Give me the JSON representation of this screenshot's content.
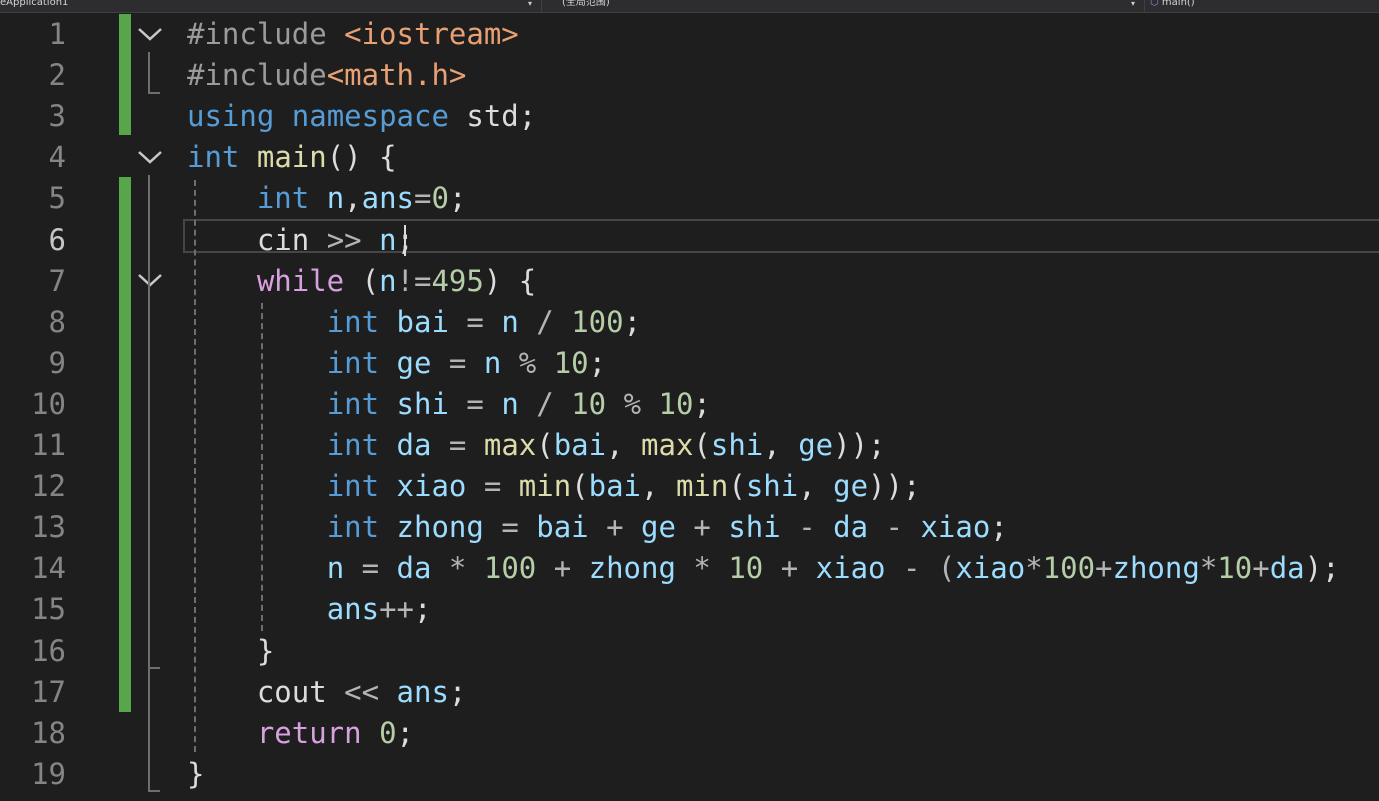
{
  "navbar": {
    "project": "eApplication1",
    "scope": "(全局范围)",
    "member": "main()"
  },
  "editor": {
    "current_line": 6,
    "lines": [
      {
        "n": "1",
        "tokens": [
          {
            "t": "#include ",
            "c": "pp"
          },
          {
            "t": "<iostream>",
            "c": "str"
          }
        ]
      },
      {
        "n": "2",
        "tokens": [
          {
            "t": "#include",
            "c": "pp"
          },
          {
            "t": "<math.h>",
            "c": "str"
          }
        ]
      },
      {
        "n": "3",
        "tokens": [
          {
            "t": "using",
            "c": "kw"
          },
          {
            "t": " ",
            "c": "pl"
          },
          {
            "t": "namespace",
            "c": "kw"
          },
          {
            "t": " std;",
            "c": "pl"
          }
        ]
      },
      {
        "n": "4",
        "tokens": [
          {
            "t": "int",
            "c": "kw"
          },
          {
            "t": " ",
            "c": "pl"
          },
          {
            "t": "main",
            "c": "fn"
          },
          {
            "t": "() {",
            "c": "pl"
          }
        ]
      },
      {
        "n": "5",
        "tokens": [
          {
            "t": "    ",
            "c": "pl"
          },
          {
            "t": "int",
            "c": "kw"
          },
          {
            "t": " ",
            "c": "pl"
          },
          {
            "t": "n",
            "c": "var"
          },
          {
            "t": ",",
            "c": "pl"
          },
          {
            "t": "ans",
            "c": "var"
          },
          {
            "t": "=",
            "c": "op"
          },
          {
            "t": "0",
            "c": "num"
          },
          {
            "t": ";",
            "c": "pl"
          }
        ]
      },
      {
        "n": "6",
        "tokens": [
          {
            "t": "    cin ",
            "c": "pl"
          },
          {
            "t": ">>",
            "c": "op"
          },
          {
            "t": " ",
            "c": "pl"
          },
          {
            "t": "n",
            "c": "var"
          },
          {
            "t": ";",
            "c": "pl"
          }
        ]
      },
      {
        "n": "7",
        "tokens": [
          {
            "t": "    ",
            "c": "pl"
          },
          {
            "t": "while",
            "c": "ctl"
          },
          {
            "t": " (",
            "c": "pl"
          },
          {
            "t": "n",
            "c": "var"
          },
          {
            "t": "!=",
            "c": "op"
          },
          {
            "t": "495",
            "c": "num"
          },
          {
            "t": ") {",
            "c": "pl"
          }
        ]
      },
      {
        "n": "8",
        "tokens": [
          {
            "t": "        ",
            "c": "pl"
          },
          {
            "t": "int",
            "c": "kw"
          },
          {
            "t": " ",
            "c": "pl"
          },
          {
            "t": "bai",
            "c": "var"
          },
          {
            "t": " = ",
            "c": "op"
          },
          {
            "t": "n",
            "c": "var"
          },
          {
            "t": " / ",
            "c": "op"
          },
          {
            "t": "100",
            "c": "num"
          },
          {
            "t": ";",
            "c": "pl"
          }
        ]
      },
      {
        "n": "9",
        "tokens": [
          {
            "t": "        ",
            "c": "pl"
          },
          {
            "t": "int",
            "c": "kw"
          },
          {
            "t": " ",
            "c": "pl"
          },
          {
            "t": "ge",
            "c": "var"
          },
          {
            "t": " = ",
            "c": "op"
          },
          {
            "t": "n",
            "c": "var"
          },
          {
            "t": " % ",
            "c": "op"
          },
          {
            "t": "10",
            "c": "num"
          },
          {
            "t": ";",
            "c": "pl"
          }
        ]
      },
      {
        "n": "10",
        "tokens": [
          {
            "t": "        ",
            "c": "pl"
          },
          {
            "t": "int",
            "c": "kw"
          },
          {
            "t": " ",
            "c": "pl"
          },
          {
            "t": "shi",
            "c": "var"
          },
          {
            "t": " = ",
            "c": "op"
          },
          {
            "t": "n",
            "c": "var"
          },
          {
            "t": " / ",
            "c": "op"
          },
          {
            "t": "10",
            "c": "num"
          },
          {
            "t": " % ",
            "c": "op"
          },
          {
            "t": "10",
            "c": "num"
          },
          {
            "t": ";",
            "c": "pl"
          }
        ]
      },
      {
        "n": "11",
        "tokens": [
          {
            "t": "        ",
            "c": "pl"
          },
          {
            "t": "int",
            "c": "kw"
          },
          {
            "t": " ",
            "c": "pl"
          },
          {
            "t": "da",
            "c": "var"
          },
          {
            "t": " = ",
            "c": "op"
          },
          {
            "t": "max",
            "c": "fn"
          },
          {
            "t": "(",
            "c": "pl"
          },
          {
            "t": "bai",
            "c": "var"
          },
          {
            "t": ", ",
            "c": "pl"
          },
          {
            "t": "max",
            "c": "fn"
          },
          {
            "t": "(",
            "c": "pl"
          },
          {
            "t": "shi",
            "c": "var"
          },
          {
            "t": ", ",
            "c": "pl"
          },
          {
            "t": "ge",
            "c": "var"
          },
          {
            "t": "));",
            "c": "pl"
          }
        ]
      },
      {
        "n": "12",
        "tokens": [
          {
            "t": "        ",
            "c": "pl"
          },
          {
            "t": "int",
            "c": "kw"
          },
          {
            "t": " ",
            "c": "pl"
          },
          {
            "t": "xiao",
            "c": "var"
          },
          {
            "t": " = ",
            "c": "op"
          },
          {
            "t": "min",
            "c": "fn"
          },
          {
            "t": "(",
            "c": "pl"
          },
          {
            "t": "bai",
            "c": "var"
          },
          {
            "t": ", ",
            "c": "pl"
          },
          {
            "t": "min",
            "c": "fn"
          },
          {
            "t": "(",
            "c": "pl"
          },
          {
            "t": "shi",
            "c": "var"
          },
          {
            "t": ", ",
            "c": "pl"
          },
          {
            "t": "ge",
            "c": "var"
          },
          {
            "t": "));",
            "c": "pl"
          }
        ]
      },
      {
        "n": "13",
        "tokens": [
          {
            "t": "        ",
            "c": "pl"
          },
          {
            "t": "int",
            "c": "kw"
          },
          {
            "t": " ",
            "c": "pl"
          },
          {
            "t": "zhong",
            "c": "var"
          },
          {
            "t": " = ",
            "c": "op"
          },
          {
            "t": "bai",
            "c": "var"
          },
          {
            "t": " + ",
            "c": "op"
          },
          {
            "t": "ge",
            "c": "var"
          },
          {
            "t": " + ",
            "c": "op"
          },
          {
            "t": "shi",
            "c": "var"
          },
          {
            "t": " - ",
            "c": "op"
          },
          {
            "t": "da",
            "c": "var"
          },
          {
            "t": " - ",
            "c": "op"
          },
          {
            "t": "xiao",
            "c": "var"
          },
          {
            "t": ";",
            "c": "pl"
          }
        ]
      },
      {
        "n": "14",
        "tokens": [
          {
            "t": "        ",
            "c": "pl"
          },
          {
            "t": "n",
            "c": "var"
          },
          {
            "t": " = ",
            "c": "op"
          },
          {
            "t": "da",
            "c": "var"
          },
          {
            "t": " * ",
            "c": "op"
          },
          {
            "t": "100",
            "c": "num"
          },
          {
            "t": " + ",
            "c": "op"
          },
          {
            "t": "zhong",
            "c": "var"
          },
          {
            "t": " * ",
            "c": "op"
          },
          {
            "t": "10",
            "c": "num"
          },
          {
            "t": " + ",
            "c": "op"
          },
          {
            "t": "xiao",
            "c": "var"
          },
          {
            "t": " - (",
            "c": "op"
          },
          {
            "t": "xiao",
            "c": "var"
          },
          {
            "t": "*",
            "c": "op"
          },
          {
            "t": "100",
            "c": "num"
          },
          {
            "t": "+",
            "c": "op"
          },
          {
            "t": "zhong",
            "c": "var"
          },
          {
            "t": "*",
            "c": "op"
          },
          {
            "t": "10",
            "c": "num"
          },
          {
            "t": "+",
            "c": "op"
          },
          {
            "t": "da",
            "c": "var"
          },
          {
            "t": ");",
            "c": "pl"
          }
        ]
      },
      {
        "n": "15",
        "tokens": [
          {
            "t": "        ",
            "c": "pl"
          },
          {
            "t": "ans",
            "c": "var"
          },
          {
            "t": "++",
            "c": "op"
          },
          {
            "t": ";",
            "c": "pl"
          }
        ]
      },
      {
        "n": "16",
        "tokens": [
          {
            "t": "    }",
            "c": "pl"
          }
        ]
      },
      {
        "n": "17",
        "tokens": [
          {
            "t": "    cout ",
            "c": "pl"
          },
          {
            "t": "<<",
            "c": "op"
          },
          {
            "t": " ",
            "c": "pl"
          },
          {
            "t": "ans",
            "c": "var"
          },
          {
            "t": ";",
            "c": "pl"
          }
        ]
      },
      {
        "n": "18",
        "tokens": [
          {
            "t": "    ",
            "c": "pl"
          },
          {
            "t": "return",
            "c": "ctl"
          },
          {
            "t": " ",
            "c": "pl"
          },
          {
            "t": "0",
            "c": "num"
          },
          {
            "t": ";",
            "c": "pl"
          }
        ]
      },
      {
        "n": "19",
        "tokens": [
          {
            "t": "}",
            "c": "pl"
          }
        ]
      }
    ]
  },
  "colors": {
    "background": "#1e1e1e",
    "keyword": "#569cd6",
    "control": "#d8a0df",
    "preprocessor": "#9b9b9b",
    "include_path": "#e8a074",
    "variable": "#9cdcfe",
    "function": "#dcdcaa",
    "number": "#b5cea8",
    "change_bar": "#57a64a"
  },
  "icons": {
    "fold": "chevron-down-icon",
    "nav_dropdown": "dropdown-arrow-icon",
    "member": "cube-icon"
  }
}
